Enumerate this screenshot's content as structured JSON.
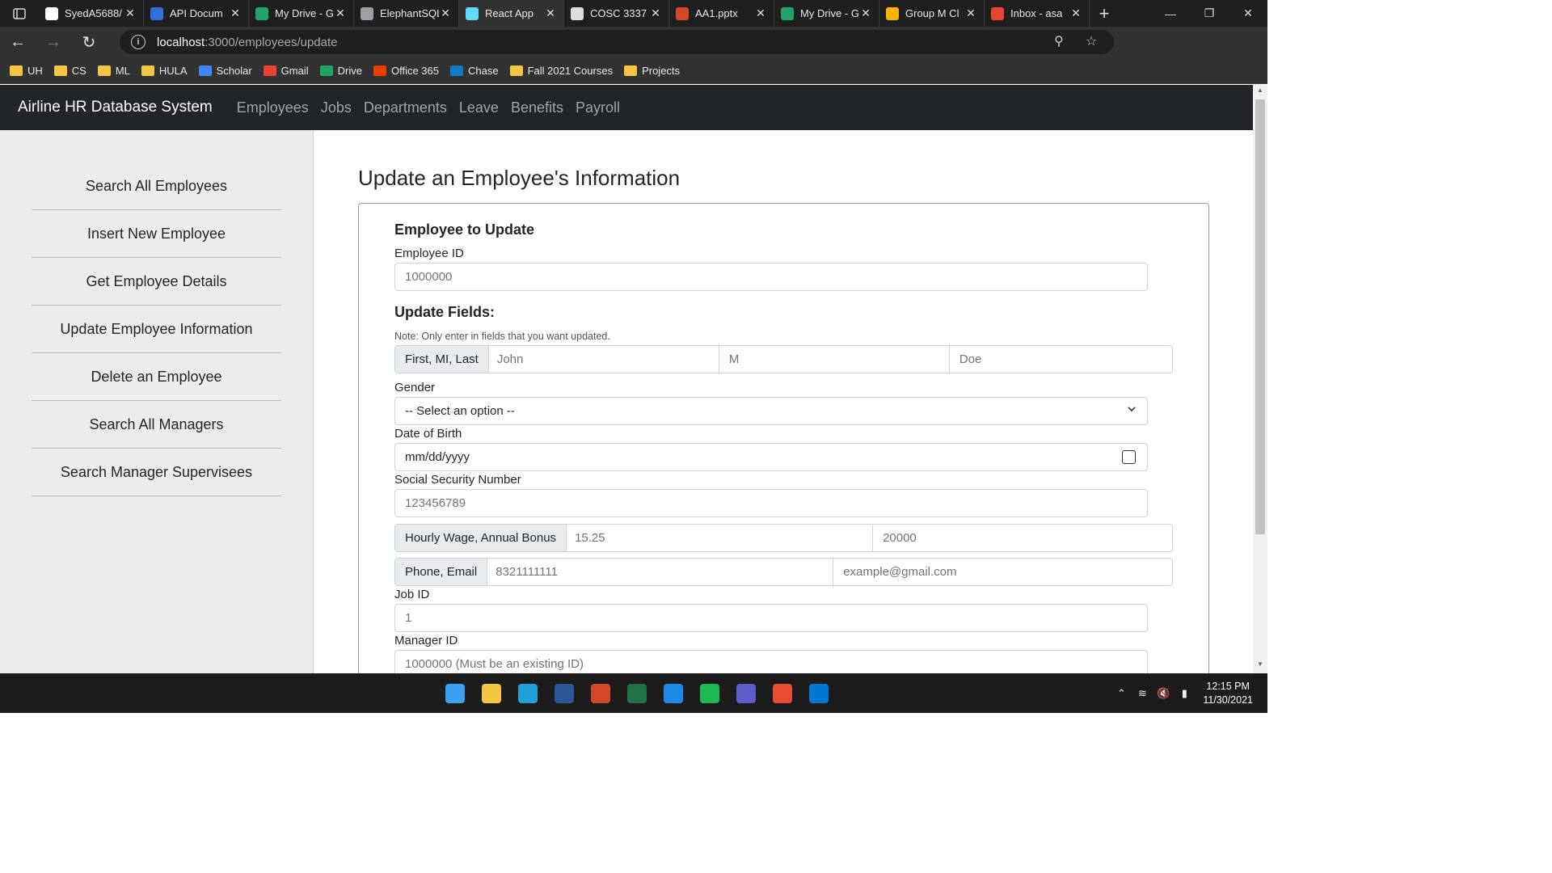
{
  "browser": {
    "tabs": [
      {
        "label": "SyedA5688/",
        "icon": "github-icon",
        "color": "#ffffff",
        "active": false
      },
      {
        "label": "API Docum",
        "icon": "api-icon",
        "color": "#2f6fde",
        "active": false
      },
      {
        "label": "My Drive - G",
        "icon": "google-drive-icon",
        "color": "#1fa463",
        "active": false
      },
      {
        "label": "ElephantSQL",
        "icon": "elephant-icon",
        "color": "#9aa0a6",
        "active": false
      },
      {
        "label": "React App",
        "icon": "react-icon",
        "color": "#61dafb",
        "active": true
      },
      {
        "label": "COSC 3337",
        "icon": "document-icon",
        "color": "#dddddd",
        "active": false
      },
      {
        "label": "AA1.pptx",
        "icon": "powerpoint-icon",
        "color": "#d24726",
        "active": false
      },
      {
        "label": "My Drive - G",
        "icon": "google-drive-icon",
        "color": "#1fa463",
        "active": false
      },
      {
        "label": "Group M Cl",
        "icon": "google-slides-icon",
        "color": "#f4b400",
        "active": false
      },
      {
        "label": "Inbox - asa",
        "icon": "gmail-icon",
        "color": "#ea4335",
        "active": false
      }
    ],
    "url_host": "localhost",
    "url_path": ":3000/employees/update",
    "bookmarks": [
      {
        "label": "UH",
        "icon": "folder-icon"
      },
      {
        "label": "CS",
        "icon": "folder-icon"
      },
      {
        "label": "ML",
        "icon": "folder-icon"
      },
      {
        "label": "HULA",
        "icon": "folder-icon"
      },
      {
        "label": "Scholar",
        "icon": "scholar-icon"
      },
      {
        "label": "Gmail",
        "icon": "gmail-icon"
      },
      {
        "label": "Drive",
        "icon": "google-drive-icon"
      },
      {
        "label": "Office 365",
        "icon": "office-icon"
      },
      {
        "label": "Chase",
        "icon": "chase-icon"
      },
      {
        "label": "Fall 2021 Courses",
        "icon": "folder-icon"
      },
      {
        "label": "Projects",
        "icon": "folder-icon"
      }
    ]
  },
  "navbar": {
    "brand": "Airline HR Database System",
    "links": [
      "Employees",
      "Jobs",
      "Departments",
      "Leave",
      "Benefits",
      "Payroll"
    ]
  },
  "sidebar": {
    "items": [
      "Search All Employees",
      "Insert New Employee",
      "Get Employee Details",
      "Update Employee Information",
      "Delete an Employee",
      "Search All Managers",
      "Search Manager Supervisees"
    ]
  },
  "main": {
    "title": "Update an Employee's Information",
    "section_target": "Employee to Update",
    "employee_id_label": "Employee ID",
    "employee_id_placeholder": "1000000",
    "section_update": "Update Fields:",
    "note": "Note: Only enter in fields that you want updated.",
    "name_addon": "First, MI, Last",
    "first_placeholder": "John",
    "mi_placeholder": "M",
    "last_placeholder": "Doe",
    "gender_label": "Gender",
    "gender_selected": "-- Select an option --",
    "dob_label": "Date of Birth",
    "dob_placeholder": "mm/dd/yyyy",
    "ssn_label": "Social Security Number",
    "ssn_placeholder": "123456789",
    "wage_addon": "Hourly Wage, Annual Bonus",
    "wage_placeholder": "15.25",
    "bonus_placeholder": "20000",
    "contact_addon": "Phone, Email",
    "phone_placeholder": "8321111111",
    "email_placeholder": "example@gmail.com",
    "job_id_label": "Job ID",
    "job_id_placeholder": "1",
    "manager_id_label": "Manager ID",
    "manager_id_placeholder": "1000000 (Must be an existing ID)"
  },
  "taskbar": {
    "apps": [
      {
        "name": "windows-start-icon",
        "color": "#3aa0f0"
      },
      {
        "name": "file-explorer-icon",
        "color": "#f4c542"
      },
      {
        "name": "edge-icon",
        "color": "#1fa0d8"
      },
      {
        "name": "word-icon",
        "color": "#2b579a"
      },
      {
        "name": "powerpoint-icon",
        "color": "#d24726"
      },
      {
        "name": "excel-icon",
        "color": "#217346"
      },
      {
        "name": "network-app-icon",
        "color": "#1e88e5"
      },
      {
        "name": "spotify-icon",
        "color": "#1db954"
      },
      {
        "name": "teams-icon",
        "color": "#5b5fc7"
      },
      {
        "name": "git-icon",
        "color": "#e94e31"
      },
      {
        "name": "vscode-icon",
        "color": "#0078d4"
      }
    ],
    "time": "12:15 PM",
    "date": "11/30/2021"
  }
}
